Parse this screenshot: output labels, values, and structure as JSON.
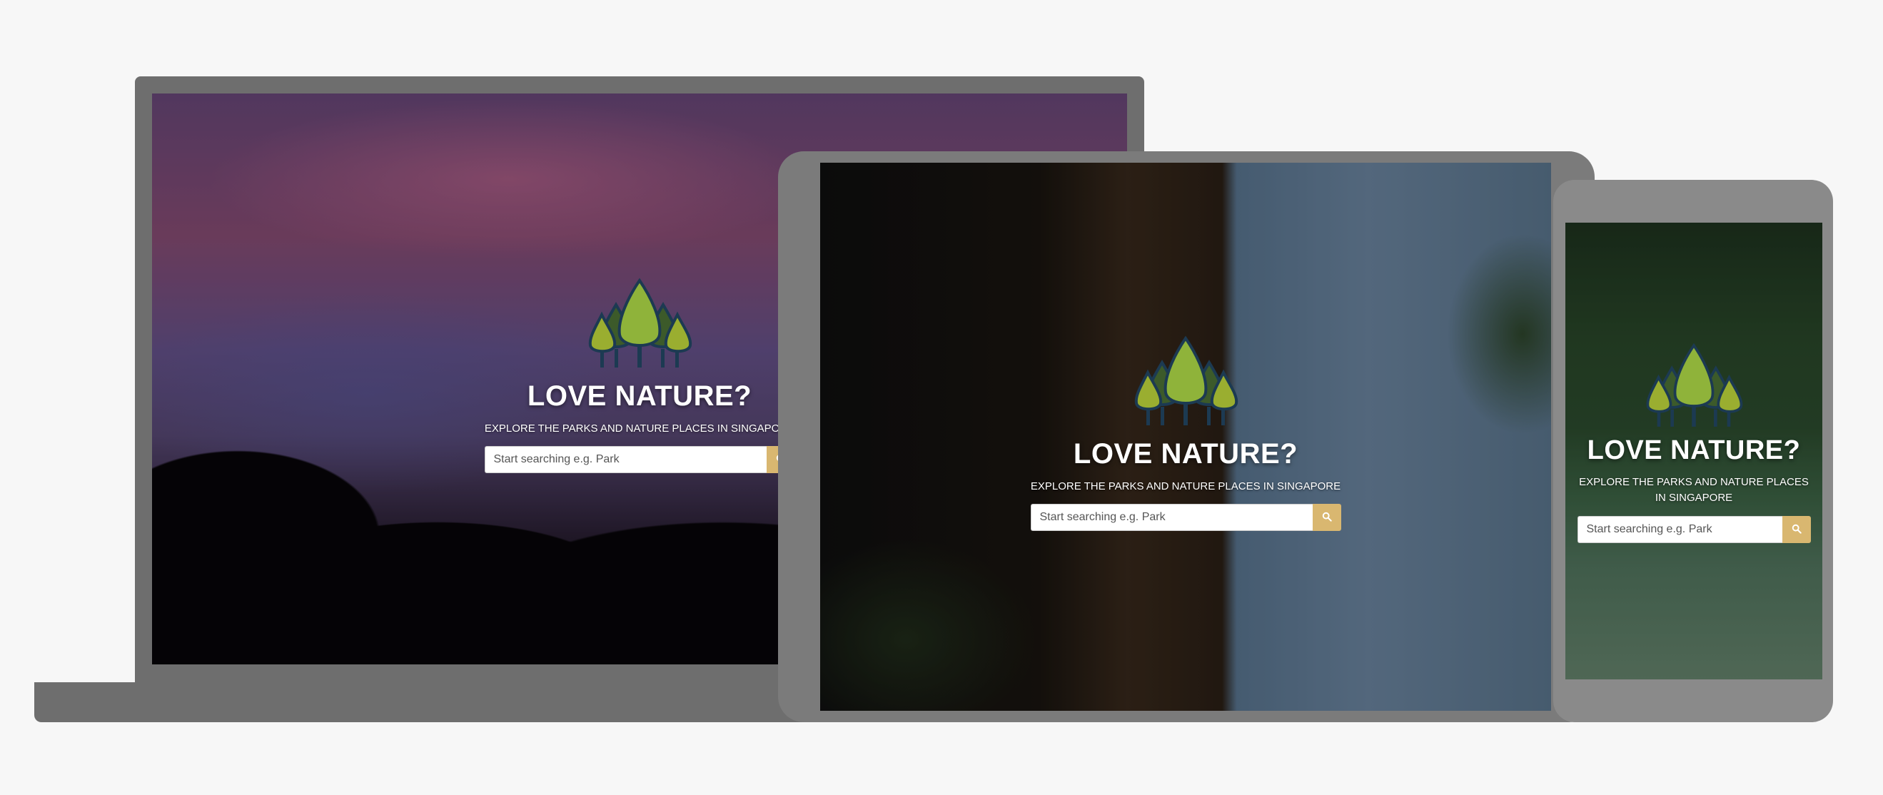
{
  "brand": {
    "tagline": "LOVE NATURE?",
    "subtitle": "EXPLORE THE PARKS AND NATURE PLACES IN SINGAPORE",
    "logo_icon": "trees-logo-icon"
  },
  "search": {
    "placeholder": "Start searching e.g. Park",
    "button_icon": "search-icon"
  },
  "colors": {
    "accent": "#d9b770",
    "tree_dark": "#3c5a2a",
    "tree_light": "#8fb33a",
    "trunk": "#1c3a52"
  }
}
